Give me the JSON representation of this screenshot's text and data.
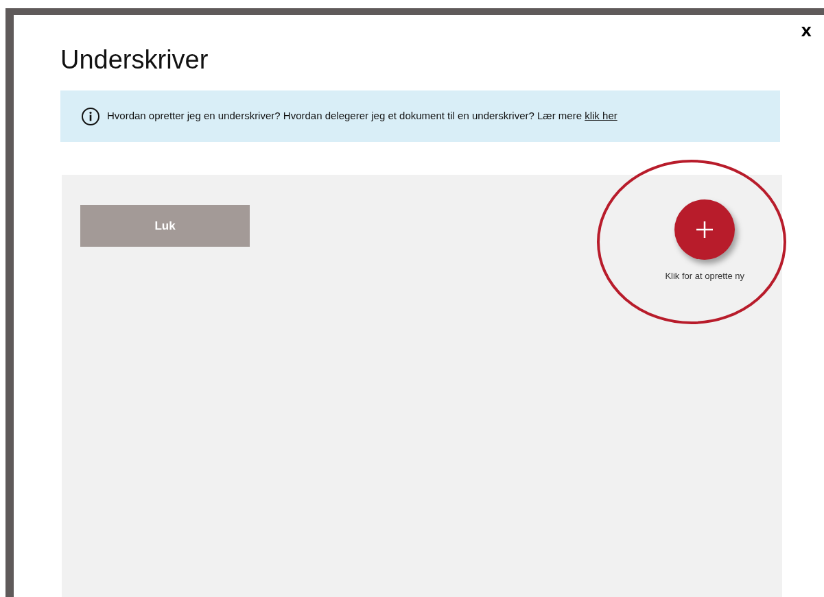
{
  "dialog": {
    "title": "Underskriver",
    "close": "X"
  },
  "info": {
    "text": "Hvordan opretter jeg en underskriver? Hvordan delegerer jeg et dokument til en underskriver? Lær mere",
    "link": "klik her"
  },
  "panel": {
    "close_button": "Luk",
    "add_label": "Klik for at oprette ny"
  }
}
